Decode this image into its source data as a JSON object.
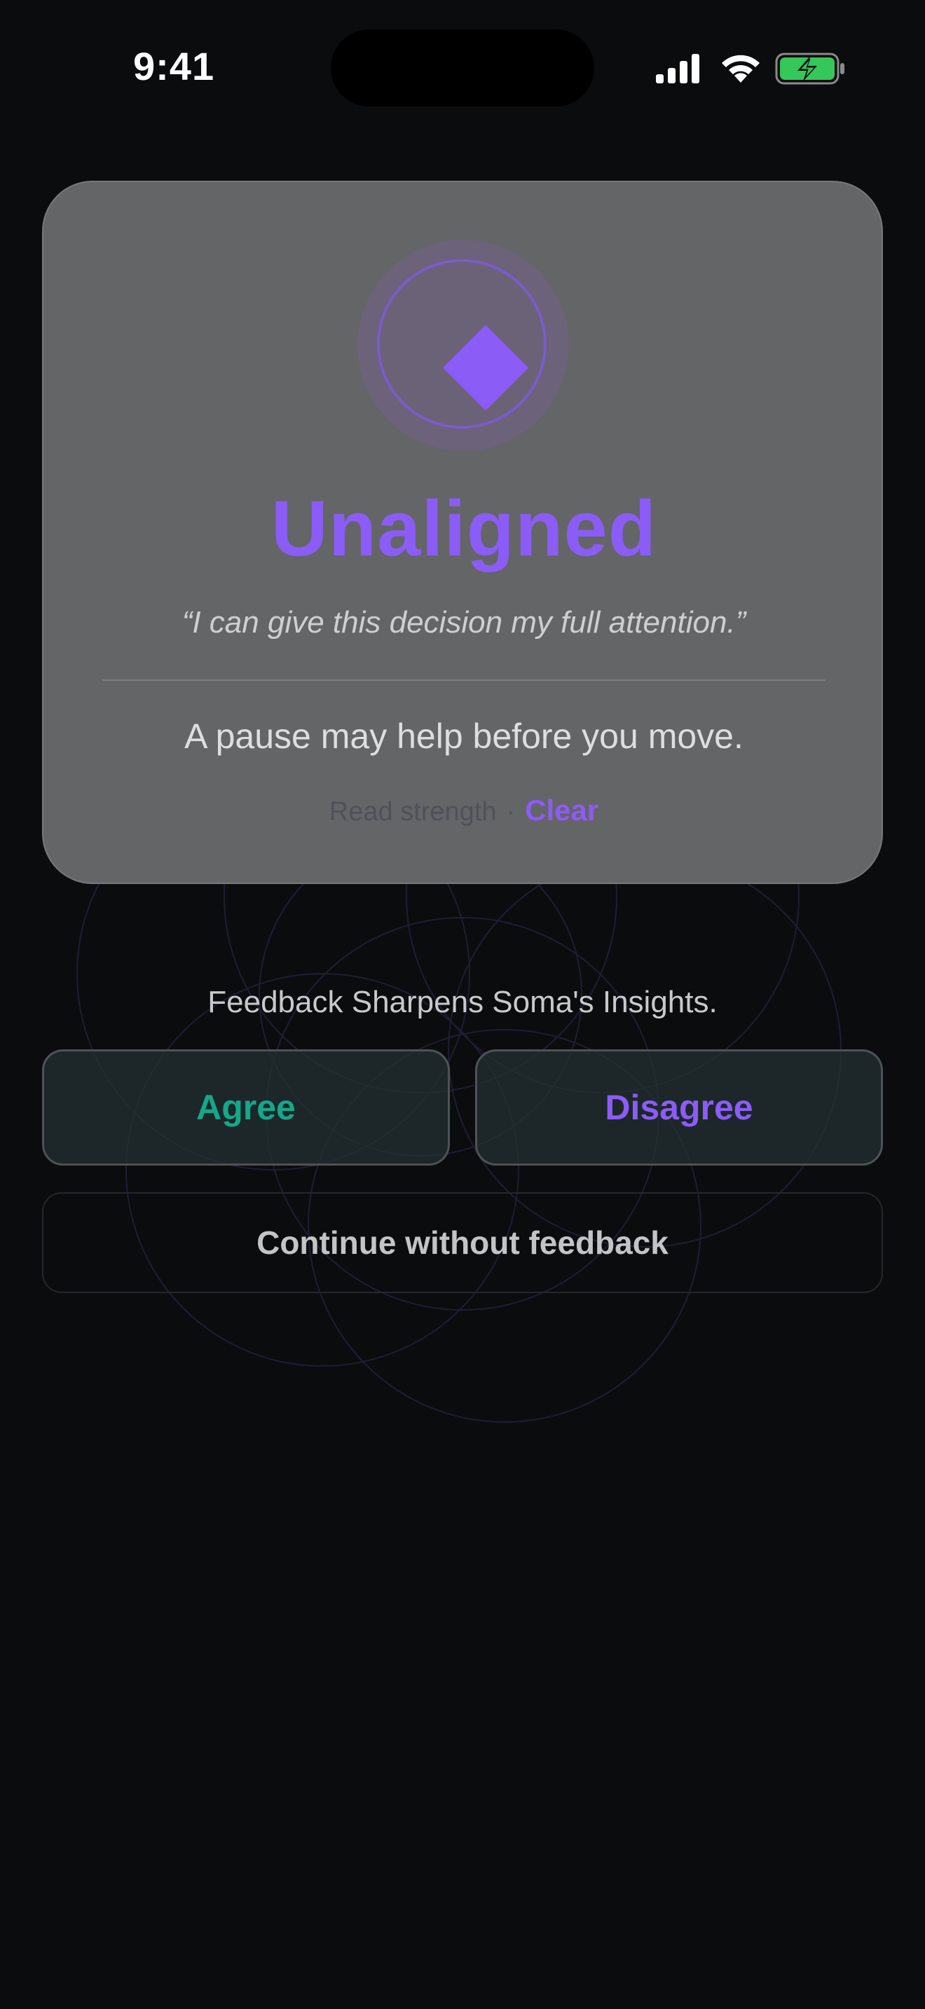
{
  "status_bar": {
    "time": "9:41"
  },
  "result": {
    "state": "Unaligned",
    "quote": "“I can give this decision my full attention.”",
    "guidance": "A pause may help before you move.",
    "read_strength_label": "Read strength",
    "separator": "·",
    "read_strength_value": "Clear",
    "icon": "diamond-icon",
    "accent_color": "#8b5cf6"
  },
  "feedback": {
    "prompt": "Feedback Sharpens Soma's Insights.",
    "agree_label": "Agree",
    "disagree_label": "Disagree",
    "continue_label": "Continue without feedback",
    "agree_color": "#14a88a"
  }
}
